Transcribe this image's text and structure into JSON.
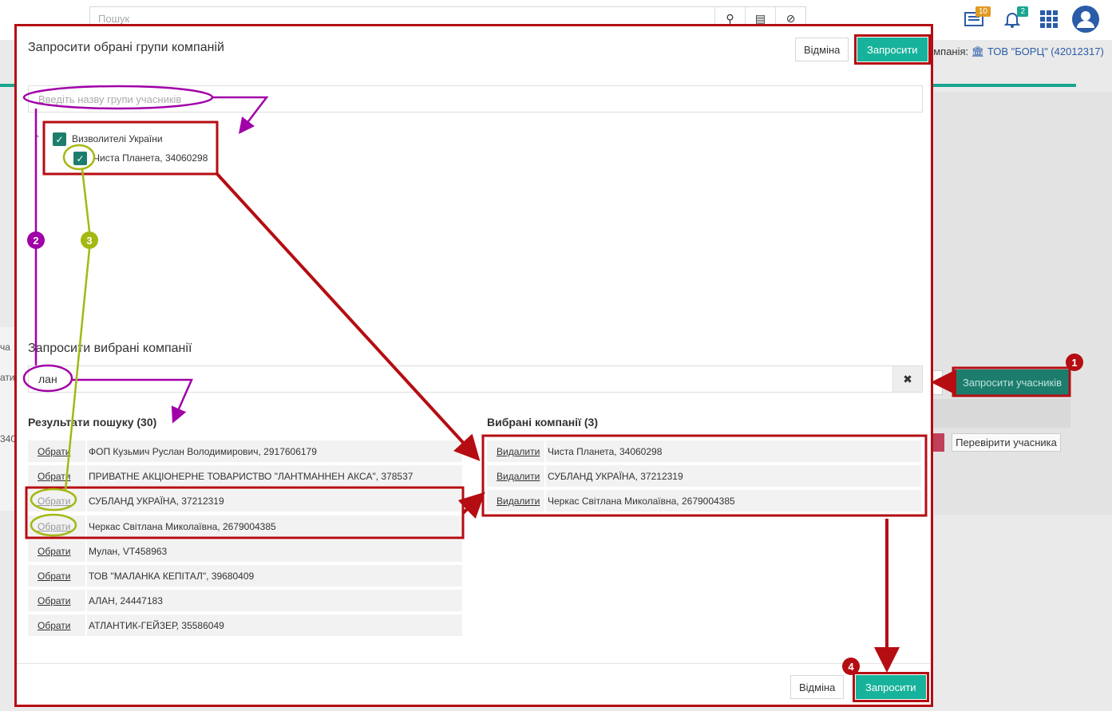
{
  "background": {
    "search_placeholder": "Пошук",
    "news_badge": "10",
    "notifications_badge": "2",
    "company_label": "омпанія:",
    "company_value": "ТОВ \"БОРЦ\" (42012317)",
    "invite_participants_label": "Запросити учасників",
    "check_participant_label": "Перевірити учасника",
    "left_fragment_1": "ча",
    "left_fragment_2": "ати",
    "left_fragment_3": "340"
  },
  "modal": {
    "title": "Запросити обрані групи компаній",
    "cancel_label": "Відміна",
    "submit_label": "Запросити",
    "group_search_placeholder": "Введіть назву групи учасників",
    "tree": {
      "group_label": "Визволителі України",
      "child_label": "Чиста Планета, 34060298"
    },
    "companies": {
      "title": "Запросити вибрані компанії",
      "search_value": "лан",
      "results_title": "Результати пошуку (30)",
      "select_label": "Обрати",
      "results": [
        "ФОП Кузьмич Руслан Володимирович, 2917606179",
        "ПРИВАТНЕ АКЦІОНЕРНЕ ТОВАРИСТВО \"ЛАНТМАННЕН АКСА\", 378537",
        "СУБЛАНД УКРАЇНА, 37212319",
        "Черкас Світлана Миколаївна, 2679004385",
        "Мулан, VT458963",
        "ТОВ \"МАЛАНКА КЕПІТАЛ\", 39680409",
        "АЛАН, 24447183",
        "АТЛАНТИК-ГЕЙЗЕР, 35586049"
      ],
      "selected_title": "Вибрані компанії (3)",
      "remove_label": "Видалити",
      "selected": [
        "Чиста Планета, 34060298",
        "СУБЛАНД УКРАЇНА, 37212319",
        "Черкас Світлана Миколаївна, 2679004385"
      ]
    }
  },
  "annotations": {
    "step1": "1",
    "step2": "2",
    "step3": "3",
    "step4": "4",
    "color_red": "#b50d12",
    "color_purple": "#a100a8",
    "color_olive": "#a4b812"
  },
  "colors": {
    "accent_green": "#17b29b",
    "checkbox_green": "#1d7d6d"
  }
}
